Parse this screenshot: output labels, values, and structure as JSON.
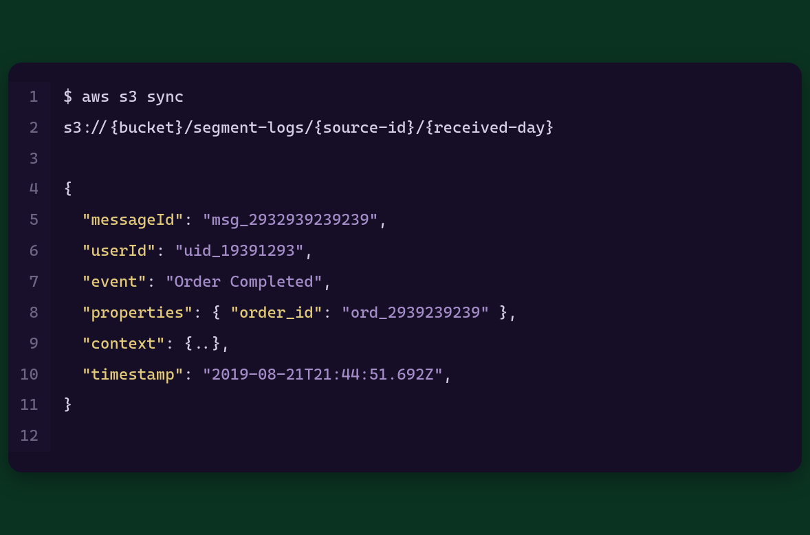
{
  "code": {
    "lines": [
      {
        "n": "1",
        "tokens": [
          {
            "t": "$ aws s3 sync",
            "c": "tok-plain"
          }
        ]
      },
      {
        "n": "2",
        "tokens": [
          {
            "t": "s3://{bucket}/segment-logs/{source-id}/{received-day}",
            "c": "tok-plain"
          }
        ]
      },
      {
        "n": "3",
        "tokens": []
      },
      {
        "n": "4",
        "tokens": [
          {
            "t": "{",
            "c": "tok-punc"
          }
        ]
      },
      {
        "n": "5",
        "tokens": [
          {
            "t": "  ",
            "c": "tok-plain"
          },
          {
            "t": "\"messageId\"",
            "c": "tok-key"
          },
          {
            "t": ": ",
            "c": "tok-colon"
          },
          {
            "t": "\"msg_2932939239239\"",
            "c": "tok-str"
          },
          {
            "t": ",",
            "c": "tok-punc"
          }
        ]
      },
      {
        "n": "6",
        "tokens": [
          {
            "t": "  ",
            "c": "tok-plain"
          },
          {
            "t": "\"userId\"",
            "c": "tok-key"
          },
          {
            "t": ": ",
            "c": "tok-colon"
          },
          {
            "t": "\"uid_19391293\"",
            "c": "tok-str"
          },
          {
            "t": ",",
            "c": "tok-punc"
          }
        ]
      },
      {
        "n": "7",
        "tokens": [
          {
            "t": "  ",
            "c": "tok-plain"
          },
          {
            "t": "\"event\"",
            "c": "tok-key"
          },
          {
            "t": ": ",
            "c": "tok-colon"
          },
          {
            "t": "\"Order Completed\"",
            "c": "tok-str"
          },
          {
            "t": ",",
            "c": "tok-punc"
          }
        ]
      },
      {
        "n": "8",
        "tokens": [
          {
            "t": "  ",
            "c": "tok-plain"
          },
          {
            "t": "\"properties\"",
            "c": "tok-key"
          },
          {
            "t": ": { ",
            "c": "tok-punc"
          },
          {
            "t": "\"order_id\"",
            "c": "tok-key"
          },
          {
            "t": ": ",
            "c": "tok-colon"
          },
          {
            "t": "\"ord_2939239239\"",
            "c": "tok-str"
          },
          {
            "t": " },",
            "c": "tok-punc"
          }
        ]
      },
      {
        "n": "9",
        "tokens": [
          {
            "t": "  ",
            "c": "tok-plain"
          },
          {
            "t": "\"context\"",
            "c": "tok-key"
          },
          {
            "t": ": {..},",
            "c": "tok-punc"
          }
        ]
      },
      {
        "n": "10",
        "tokens": [
          {
            "t": "  ",
            "c": "tok-plain"
          },
          {
            "t": "\"timestamp\"",
            "c": "tok-key"
          },
          {
            "t": ": ",
            "c": "tok-colon"
          },
          {
            "t": "\"2019-08-21T21:44:51.692Z\"",
            "c": "tok-str"
          },
          {
            "t": ",",
            "c": "tok-punc"
          }
        ]
      },
      {
        "n": "11",
        "tokens": [
          {
            "t": "}",
            "c": "tok-punc"
          }
        ]
      },
      {
        "n": "12",
        "tokens": []
      }
    ]
  }
}
